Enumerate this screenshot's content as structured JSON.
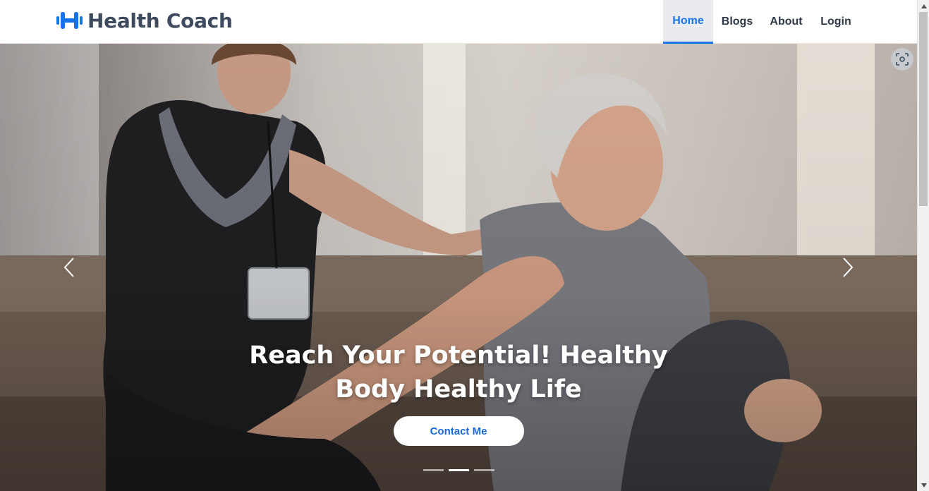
{
  "brand": {
    "name": "Health Coach",
    "icon": "dumbbell-icon"
  },
  "nav": {
    "items": [
      {
        "label": "Home",
        "active": true
      },
      {
        "label": "Blogs",
        "active": false
      },
      {
        "label": "About",
        "active": false
      },
      {
        "label": "Login",
        "active": false
      }
    ]
  },
  "hero": {
    "title": "Reach Your Potential! Healthy Body Healthy Life",
    "cta_label": "Contact Me",
    "slide_count": 3,
    "active_slide": 2,
    "prev_icon": "chevron-left-icon",
    "next_icon": "chevron-right-icon",
    "overlay_icon": "screenshot-scan-icon"
  },
  "colors": {
    "accent": "#1773e8",
    "brand_text": "#3e4a5e",
    "nav_text": "#2f3a48",
    "active_bg": "#e9ebee"
  }
}
